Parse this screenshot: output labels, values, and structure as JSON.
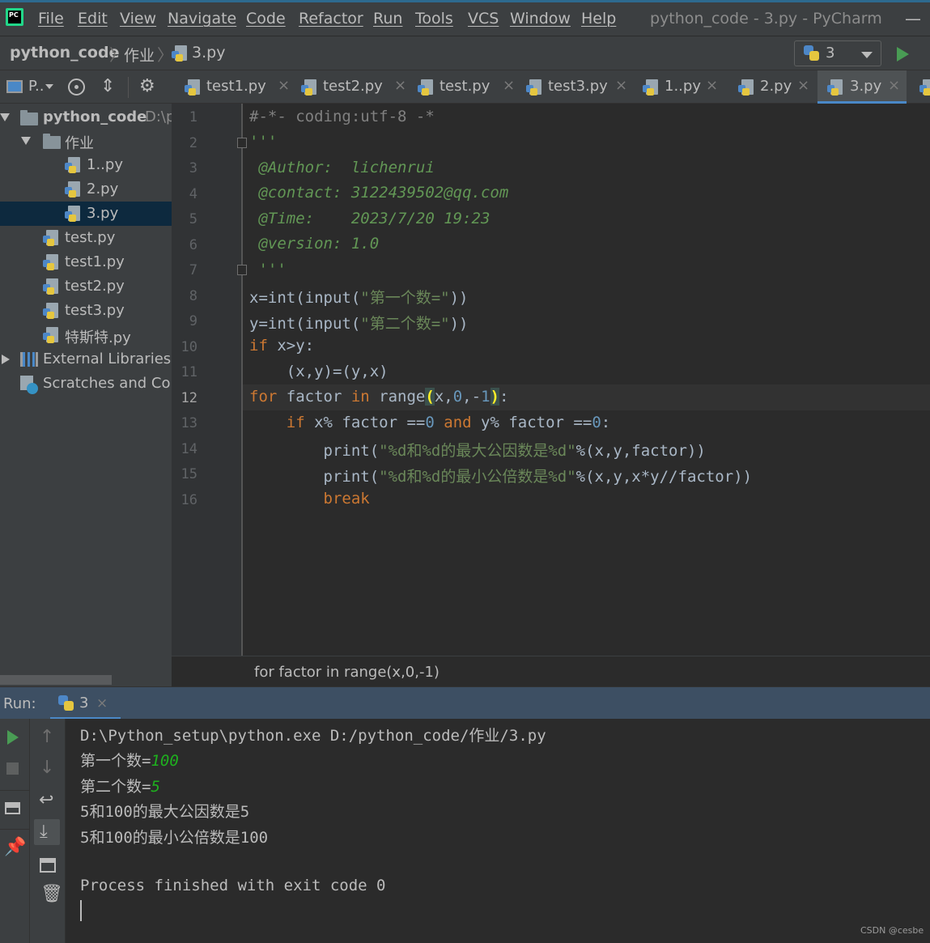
{
  "menu": {
    "items": [
      "File",
      "Edit",
      "View",
      "Navigate",
      "Code",
      "Refactor",
      "Run",
      "Tools",
      "VCS",
      "Window",
      "Help"
    ],
    "title": "python_code - 3.py - PyCharm",
    "logo_text": "PC"
  },
  "nav": {
    "project": "python_code",
    "folder": "作业",
    "file": "3.py",
    "run_config": "3"
  },
  "left_toolbar": {
    "project_label": "P.."
  },
  "tabs": [
    {
      "label": "test1.py"
    },
    {
      "label": "test2.py"
    },
    {
      "label": "test.py"
    },
    {
      "label": "test3.py"
    },
    {
      "label": "1..py"
    },
    {
      "label": "2.py"
    },
    {
      "label": "3.py",
      "active": true
    }
  ],
  "tree": {
    "root": "python_code",
    "root_path": "D:\\p",
    "folder": "作业",
    "folder_files": [
      "1..py",
      "2.py",
      "3.py"
    ],
    "files": [
      "test.py",
      "test1.py",
      "test2.py",
      "test3.py",
      "特斯特.py"
    ],
    "external": "External Libraries",
    "scratches": "Scratches and Con"
  },
  "line_numbers": [
    "1",
    "2",
    "3",
    "4",
    "5",
    "6",
    "7",
    "8",
    "9",
    "10",
    "11",
    "12",
    "13",
    "14",
    "15",
    "16"
  ],
  "code": {
    "l1": "#-*- coding:utf-8 -*",
    "l2": "'''",
    "l3": " @Author:  lichenrui",
    "l4": " @contact: 3122439502@qq.com",
    "l5": " @Time:    2023/7/20 19:23",
    "l6": " @version: 1.0",
    "l7": " '''",
    "l8_a": "x=int(input(",
    "l8_s": "\"第一个数=\"",
    "l8_b": "))",
    "l9_a": "y=int(input(",
    "l9_s": "\"第二个数=\"",
    "l9_b": "))",
    "l10_k": "if",
    "l10_b": " x>y:",
    "l11": "    (x,y)=(y,x)",
    "l12_k1": "for",
    "l12_a": " factor ",
    "l12_k2": "in",
    "l12_b": " range",
    "l12_p1": "(",
    "l12_c": "x,",
    "l12_n1": "0",
    "l12_d": ",-",
    "l12_n2": "1",
    "l12_p2": ")",
    "l12_e": ":",
    "l13_k": "if",
    "l13_a": " x% factor ==",
    "l13_n": "0",
    "l13_k2": " and",
    "l13_b": " y% factor ==",
    "l13_n2": "0",
    "l13_c": ":",
    "l14_a": "print(",
    "l14_s": "\"%d和%d的最大公因数是%d\"",
    "l14_b": "%(x,y,factor))",
    "l15_a": "print(",
    "l15_s": "\"%d和%d的最小公倍数是%d\"",
    "l15_b": "%(x,y,x*y//factor))",
    "l16_k": "break"
  },
  "breadcrumb_bottom": "for factor in range(x,0,-1)",
  "run": {
    "label": "Run:",
    "tab": "3",
    "output": {
      "cmd": "D:\\Python_setup\\python.exe D:/python_code/作业/3.py",
      "p1": "第一个数=",
      "i1": "100",
      "p2": "第二个数=",
      "i2": "5",
      "r1": "5和100的最大公因数是5",
      "r2": "5和100的最小公倍数是100",
      "exit": "Process finished with exit code 0"
    }
  },
  "watermark": "CSDN @cesbe"
}
